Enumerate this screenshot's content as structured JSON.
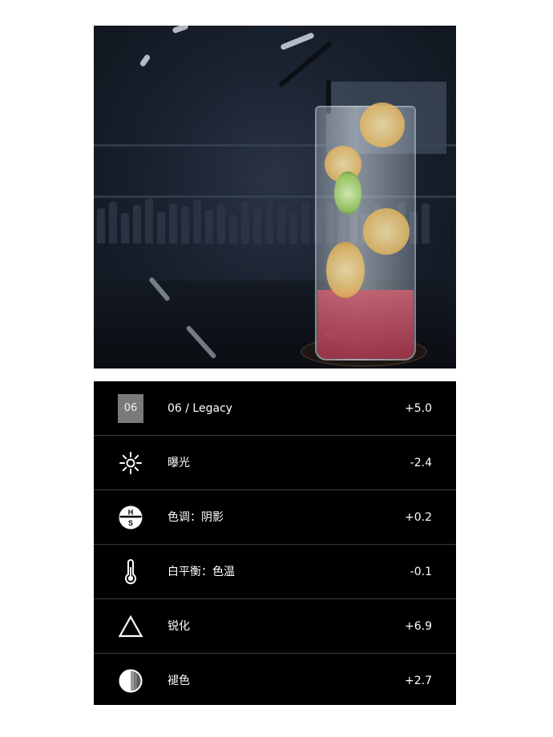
{
  "photo": {
    "alt_name": "drink-photo"
  },
  "settings": [
    {
      "icon": "preset-badge",
      "badge_text": "06",
      "label": "06 / Legacy",
      "value": "+5.0"
    },
    {
      "icon": "sun-icon",
      "label": "曝光",
      "value": "-2.4"
    },
    {
      "icon": "hue-shadow-icon",
      "icon_top": "H",
      "icon_bottom": "S",
      "label": "色调：阴影",
      "value": "+0.2"
    },
    {
      "icon": "thermometer-icon",
      "label": "白平衡：色温",
      "value": "-0.1"
    },
    {
      "icon": "triangle-icon",
      "label": "锐化",
      "value": "+6.9"
    },
    {
      "icon": "fade-icon",
      "label": "褪色",
      "value": "+2.7"
    }
  ]
}
